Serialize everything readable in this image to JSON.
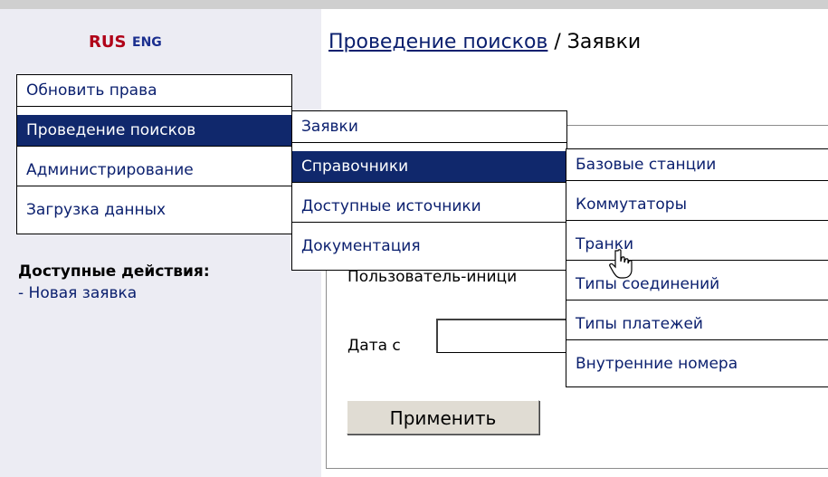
{
  "lang": {
    "rus": "RUS",
    "eng": "ENG"
  },
  "breadcrumb": {
    "link": "Проведение поисков",
    "separator": " / ",
    "current": "Заявки"
  },
  "main_menu": [
    {
      "label": "Обновить права",
      "selected": false
    },
    {
      "label": "Проведение поисков",
      "selected": true
    },
    {
      "label": "Администрирование",
      "selected": false
    },
    {
      "label": "Загрузка данных",
      "selected": false
    }
  ],
  "search_menu": [
    {
      "label": "Заявки",
      "selected": false
    },
    {
      "label": "Справочники",
      "selected": true
    },
    {
      "label": "Доступные источники",
      "selected": false
    },
    {
      "label": "Документация",
      "selected": false
    }
  ],
  "reference_menu": [
    {
      "label": "Базовые станции",
      "selected": false
    },
    {
      "label": "Коммутаторы",
      "selected": false
    },
    {
      "label": "Транки",
      "selected": false
    },
    {
      "label": "Типы соединений",
      "selected": false
    },
    {
      "label": "Типы платежей",
      "selected": false
    },
    {
      "label": "Внутренние номера",
      "selected": false
    }
  ],
  "actions": {
    "title": "Доступные действия:",
    "items": [
      "- Новая заявка"
    ]
  },
  "filter": {
    "user_label": "Пользователь-иници",
    "date_label": "Дата с",
    "date_value": "",
    "apply_label": "Применить"
  },
  "colors": {
    "menu_selected_bg": "#10286c",
    "link": "#0a1f6e",
    "lang_active": "#b00018"
  }
}
